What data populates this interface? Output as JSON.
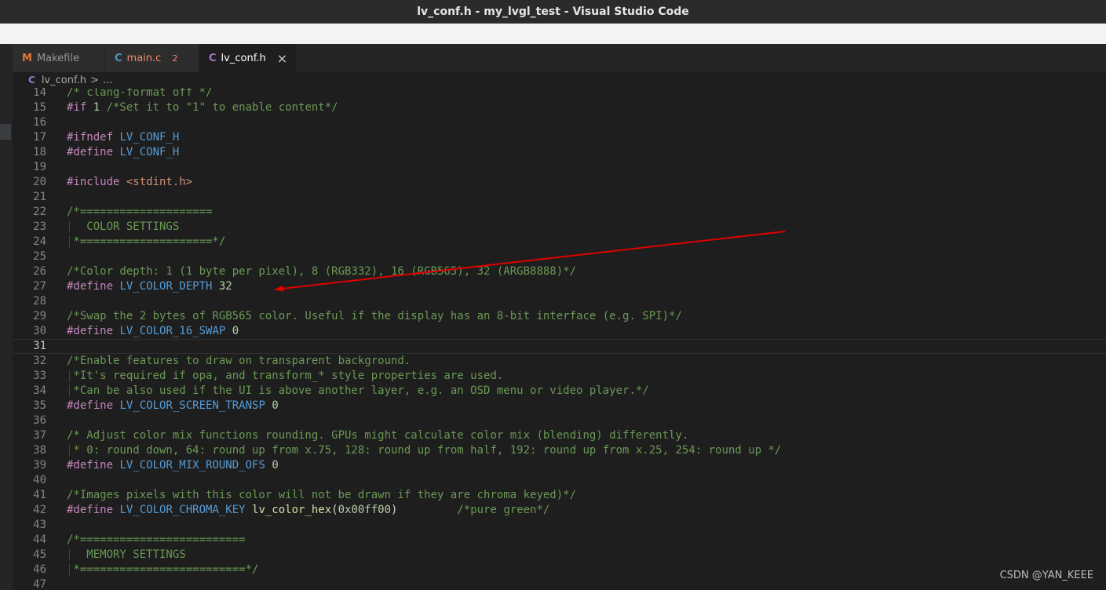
{
  "window": {
    "title": "lv_conf.h - my_lvgl_test - Visual Studio Code"
  },
  "tabs": [
    {
      "icon": "M",
      "label": "Makefile",
      "badge": "",
      "active": false
    },
    {
      "icon": "C",
      "label": "main.c",
      "badge": "2",
      "active": false
    },
    {
      "icon": "C",
      "label": "lv_conf.h",
      "badge": "",
      "active": true
    }
  ],
  "breadcrumb": {
    "icon": "C",
    "file": "lv_conf.h",
    "separator": ">",
    "rest": "..."
  },
  "editor": {
    "current_line": 31,
    "lines": [
      {
        "n": "14",
        "tokens": [
          [
            "cm",
            "/* clang-format off */"
          ]
        ]
      },
      {
        "n": "15",
        "tokens": [
          [
            "kw",
            "#if "
          ],
          [
            "num",
            "1 "
          ],
          [
            "cm",
            "/*Set it to \"1\" to enable content*/"
          ]
        ]
      },
      {
        "n": "16",
        "tokens": []
      },
      {
        "n": "17",
        "tokens": [
          [
            "kw",
            "#ifndef "
          ],
          [
            "mac",
            "LV_CONF_H"
          ]
        ]
      },
      {
        "n": "18",
        "tokens": [
          [
            "kw",
            "#define "
          ],
          [
            "mac",
            "LV_CONF_H"
          ]
        ]
      },
      {
        "n": "19",
        "tokens": []
      },
      {
        "n": "20",
        "tokens": [
          [
            "kw",
            "#include "
          ],
          [
            "str",
            "<stdint.h>"
          ]
        ]
      },
      {
        "n": "21",
        "tokens": []
      },
      {
        "n": "22",
        "tokens": [
          [
            "cm",
            "/*===================="
          ]
        ]
      },
      {
        "n": "23",
        "tokens": [
          [
            "cm",
            "   COLOR SETTINGS"
          ]
        ]
      },
      {
        "n": "24",
        "tokens": [
          [
            "cm",
            " *====================*/"
          ]
        ]
      },
      {
        "n": "25",
        "tokens": []
      },
      {
        "n": "26",
        "tokens": [
          [
            "cm",
            "/*Color depth: 1 (1 byte per pixel), 8 (RGB332), 16 (RGB565), 32 (ARGB8888)*/"
          ]
        ]
      },
      {
        "n": "27",
        "tokens": [
          [
            "kw",
            "#define "
          ],
          [
            "mac",
            "LV_COLOR_DEPTH "
          ],
          [
            "num",
            "32"
          ]
        ]
      },
      {
        "n": "28",
        "tokens": []
      },
      {
        "n": "29",
        "tokens": [
          [
            "cm",
            "/*Swap the 2 bytes of RGB565 color. Useful if the display has an 8-bit interface (e.g. SPI)*/"
          ]
        ]
      },
      {
        "n": "30",
        "tokens": [
          [
            "kw",
            "#define "
          ],
          [
            "mac",
            "LV_COLOR_16_SWAP "
          ],
          [
            "num",
            "0"
          ]
        ]
      },
      {
        "n": "31",
        "tokens": []
      },
      {
        "n": "32",
        "tokens": [
          [
            "cm",
            "/*Enable features to draw on transparent background."
          ]
        ]
      },
      {
        "n": "33",
        "tokens": [
          [
            "cm",
            " *It's required if opa, and transform_* style properties are used."
          ]
        ]
      },
      {
        "n": "34",
        "tokens": [
          [
            "cm",
            " *Can be also used if the UI is above another layer, e.g. an OSD menu or video player.*/"
          ]
        ]
      },
      {
        "n": "35",
        "tokens": [
          [
            "kw",
            "#define "
          ],
          [
            "mac",
            "LV_COLOR_SCREEN_TRANSP "
          ],
          [
            "num",
            "0"
          ]
        ]
      },
      {
        "n": "36",
        "tokens": []
      },
      {
        "n": "37",
        "tokens": [
          [
            "cm",
            "/* Adjust color mix functions rounding. GPUs might calculate color mix (blending) differently."
          ]
        ]
      },
      {
        "n": "38",
        "tokens": [
          [
            "cm",
            " * 0: round down, 64: round up from x.75, 128: round up from half, 192: round up from x.25, 254: round up */"
          ]
        ]
      },
      {
        "n": "39",
        "tokens": [
          [
            "kw",
            "#define "
          ],
          [
            "mac",
            "LV_COLOR_MIX_ROUND_OFS "
          ],
          [
            "num",
            "0"
          ]
        ]
      },
      {
        "n": "40",
        "tokens": []
      },
      {
        "n": "41",
        "tokens": [
          [
            "cm",
            "/*Images pixels with this color will not be drawn if they are chroma keyed)*/"
          ]
        ]
      },
      {
        "n": "42",
        "tokens": [
          [
            "kw",
            "#define "
          ],
          [
            "mac",
            "LV_COLOR_CHROMA_KEY "
          ],
          [
            "fn",
            "lv_color_hex"
          ],
          [
            "pl",
            "("
          ],
          [
            "num",
            "0x00ff00"
          ],
          [
            "pl",
            ")"
          ],
          [
            "pl",
            "         "
          ],
          [
            "cm",
            "/*pure green*/"
          ]
        ]
      },
      {
        "n": "43",
        "tokens": []
      },
      {
        "n": "44",
        "tokens": [
          [
            "cm",
            "/*========================="
          ]
        ]
      },
      {
        "n": "45",
        "tokens": [
          [
            "cm",
            "   MEMORY SETTINGS"
          ]
        ]
      },
      {
        "n": "46",
        "tokens": [
          [
            "cm",
            " *=========================*/"
          ]
        ]
      },
      {
        "n": "47",
        "tokens": []
      }
    ]
  },
  "watermark": "CSDN @YAN_KEEE",
  "colors": {
    "comment": "#6a9955",
    "keyword": "#c586c0",
    "macro": "#569cd6",
    "number": "#b5cea8",
    "string": "#ce9178",
    "function": "#dcdcaa",
    "annotation_arrow": "#e00000"
  }
}
